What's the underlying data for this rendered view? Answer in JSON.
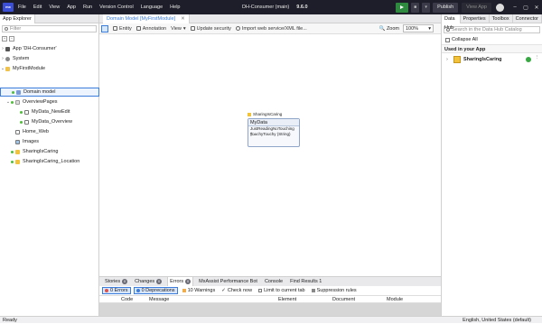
{
  "window": {
    "title": "DH-Consumer (main)",
    "version": "9.6.0",
    "menu": [
      "File",
      "Edit",
      "View",
      "App",
      "Run",
      "Version Control",
      "Language",
      "Help"
    ],
    "publish_label": "Publish",
    "view_app_label": "View App",
    "logo_text": "mx"
  },
  "left_panel": {
    "tab": "App Explorer",
    "filter_placeholder": "Filter",
    "tree": [
      {
        "label": "App 'DH-Consumer'",
        "icon": "app-icon"
      },
      {
        "label": "System",
        "icon": "gear-icon"
      },
      {
        "label": "MyFirstModule",
        "icon": "module-icon"
      },
      {
        "label": "Domain model",
        "icon": "domain-model-icon"
      },
      {
        "label": "OverviewPages",
        "icon": "folder-icon"
      },
      {
        "label": "MyData_NewEdit",
        "icon": "page-icon"
      },
      {
        "label": "MyData_Overview",
        "icon": "page-icon"
      },
      {
        "label": "Home_Web",
        "icon": "page-icon"
      },
      {
        "label": "Images",
        "icon": "image-collection-icon"
      },
      {
        "label": "SharingIsCaring",
        "icon": "module-icon"
      },
      {
        "label": "SharingIsCaring_Location",
        "icon": "module-icon"
      }
    ]
  },
  "editor": {
    "tab_label": "Domain Model [MyFirstModule]",
    "toolbar": {
      "entity": "Entity",
      "annotation": "Annotation",
      "view": "View",
      "update_security": "Update security",
      "import": "Import web service/XML file...",
      "zoom_label": "Zoom",
      "zoom_value": "100%"
    },
    "canvas": {
      "module_tag": "SharingIsCaring",
      "entity_name": "MyData",
      "attributes": [
        "JustReadingNoTouching (...",
        "TouchyTouchy (String)"
      ]
    }
  },
  "bottom_panel": {
    "tabs": [
      {
        "label": "Stories",
        "badge": "0"
      },
      {
        "label": "Changes",
        "badge": "0"
      },
      {
        "label": "Errors",
        "badge": "0"
      },
      {
        "label": "MxAssist Performance Bot",
        "badge": ""
      },
      {
        "label": "Console",
        "badge": ""
      },
      {
        "label": "Find Results 1",
        "badge": ""
      }
    ],
    "filters": {
      "errors": "0 Errors",
      "deprecations": "0 Deprecations",
      "warnings": "10 Warnings",
      "check_now": "Check now",
      "limit": "Limit to current tab",
      "suppression": "Suppression rules"
    },
    "columns": [
      "Code",
      "Message",
      "Element",
      "Document",
      "Module"
    ]
  },
  "right_panel": {
    "tabs": [
      "Data Hub",
      "Properties",
      "Toolbox",
      "Connector"
    ],
    "search_placeholder": "Search in the Data Hub Catalog",
    "collapse_all": "Collapse All",
    "section": "Used in your App",
    "module": "SharingIsCaring"
  },
  "status": {
    "left": "Ready",
    "right": "English, United States (default)"
  }
}
